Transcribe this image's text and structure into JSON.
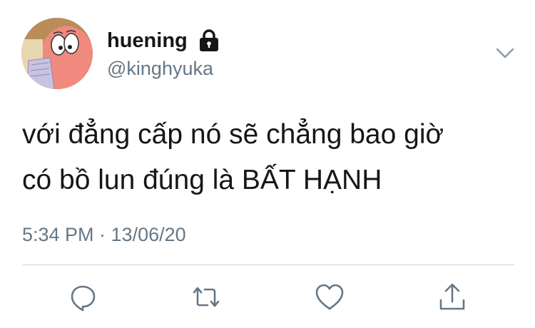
{
  "tweet": {
    "display_name": "huening",
    "handle": "@kinghyuka",
    "text_lines": [
      "với đẳng cấp nó sẽ chẳng bao giờ",
      "có bồ lun đúng là BẤT HẠNH"
    ],
    "timestamp": "5:34 PM · 13/06/20",
    "protected_icon": "lock-icon",
    "menu_icon": "chevron-down-icon"
  },
  "actions": {
    "reply_icon": "reply-icon",
    "retweet_icon": "retweet-icon",
    "like_icon": "heart-icon",
    "share_icon": "share-icon"
  },
  "colors": {
    "text_primary": "#14171a",
    "text_secondary": "#657786",
    "divider": "#ccd6dd",
    "icon": "#657786"
  }
}
